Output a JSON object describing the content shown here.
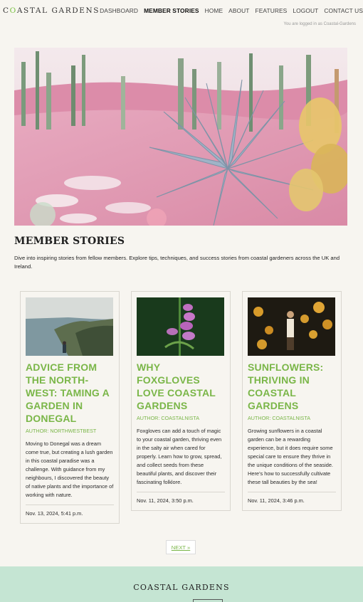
{
  "header": {
    "logo_prefix": "C",
    "logo_accent": "O",
    "logo_rest": "ASTAL GARDENS",
    "nav": [
      "DASHBOARD",
      "MEMBER STORIES",
      "HOME",
      "ABOUT",
      "FEATURES",
      "LOGOUT",
      "CONTACT US"
    ],
    "active_nav": "MEMBER STORIES",
    "login_status": "You are logged in as Coastal-Gardens"
  },
  "hero": {
    "image": "desert-garden-illustration"
  },
  "main": {
    "title": "MEMBER STORIES",
    "intro": "Dive into inspiring stories from fellow members. Explore tips, techniques, and success stories from coastal gardeners across the UK and Ireland."
  },
  "cards": [
    {
      "title": "ADVICE FROM THE NORTH-WEST: TAMING A GARDEN IN DONEGAL",
      "author": "AUTHOR: NORTHWESTBEST",
      "excerpt": "Moving to Donegal was a dream come true, but creating a lush garden in this coastal paradise was a challenge. With guidance from my neighbours, I discovered the beauty of native plants and the importance of working with nature.",
      "date": "Nov. 13, 2024, 5:41 p.m.",
      "image": "coastal-cliff-photo"
    },
    {
      "title": "WHY FOXGLOVES LOVE COASTAL GARDENS",
      "author": "AUTHOR: COASTALNISTA",
      "excerpt": "Foxgloves can add a touch of magic to your coastal garden, thriving even in the salty air when cared for properly. Learn how to grow, spread, and collect seeds from these beautiful plants, and discover their fascinating folklore.",
      "date": "Nov. 11, 2024, 3:50 p.m.",
      "image": "foxglove-photo"
    },
    {
      "title": "SUNFLOWERS: THRIVING IN COASTAL GARDENS",
      "author": "AUTHOR: COASTALNISTA",
      "excerpt": "Growing sunflowers in a coastal garden can be a rewarding experience, but it does require some special care to ensure they thrive in the unique conditions of the seaside. Here’s how to successfully cultivate these tall beauties by the sea!",
      "date": "Nov. 11, 2024, 3:46 p.m.",
      "image": "sunflower-field-photo"
    }
  ],
  "pagination": {
    "next_label": "NEXT »"
  },
  "footer": {
    "logo": "COASTAL GARDENS"
  },
  "colors": {
    "accent": "#7ab648",
    "footer_bg": "#c5e5d3",
    "page_bg": "#f7f5f0"
  }
}
